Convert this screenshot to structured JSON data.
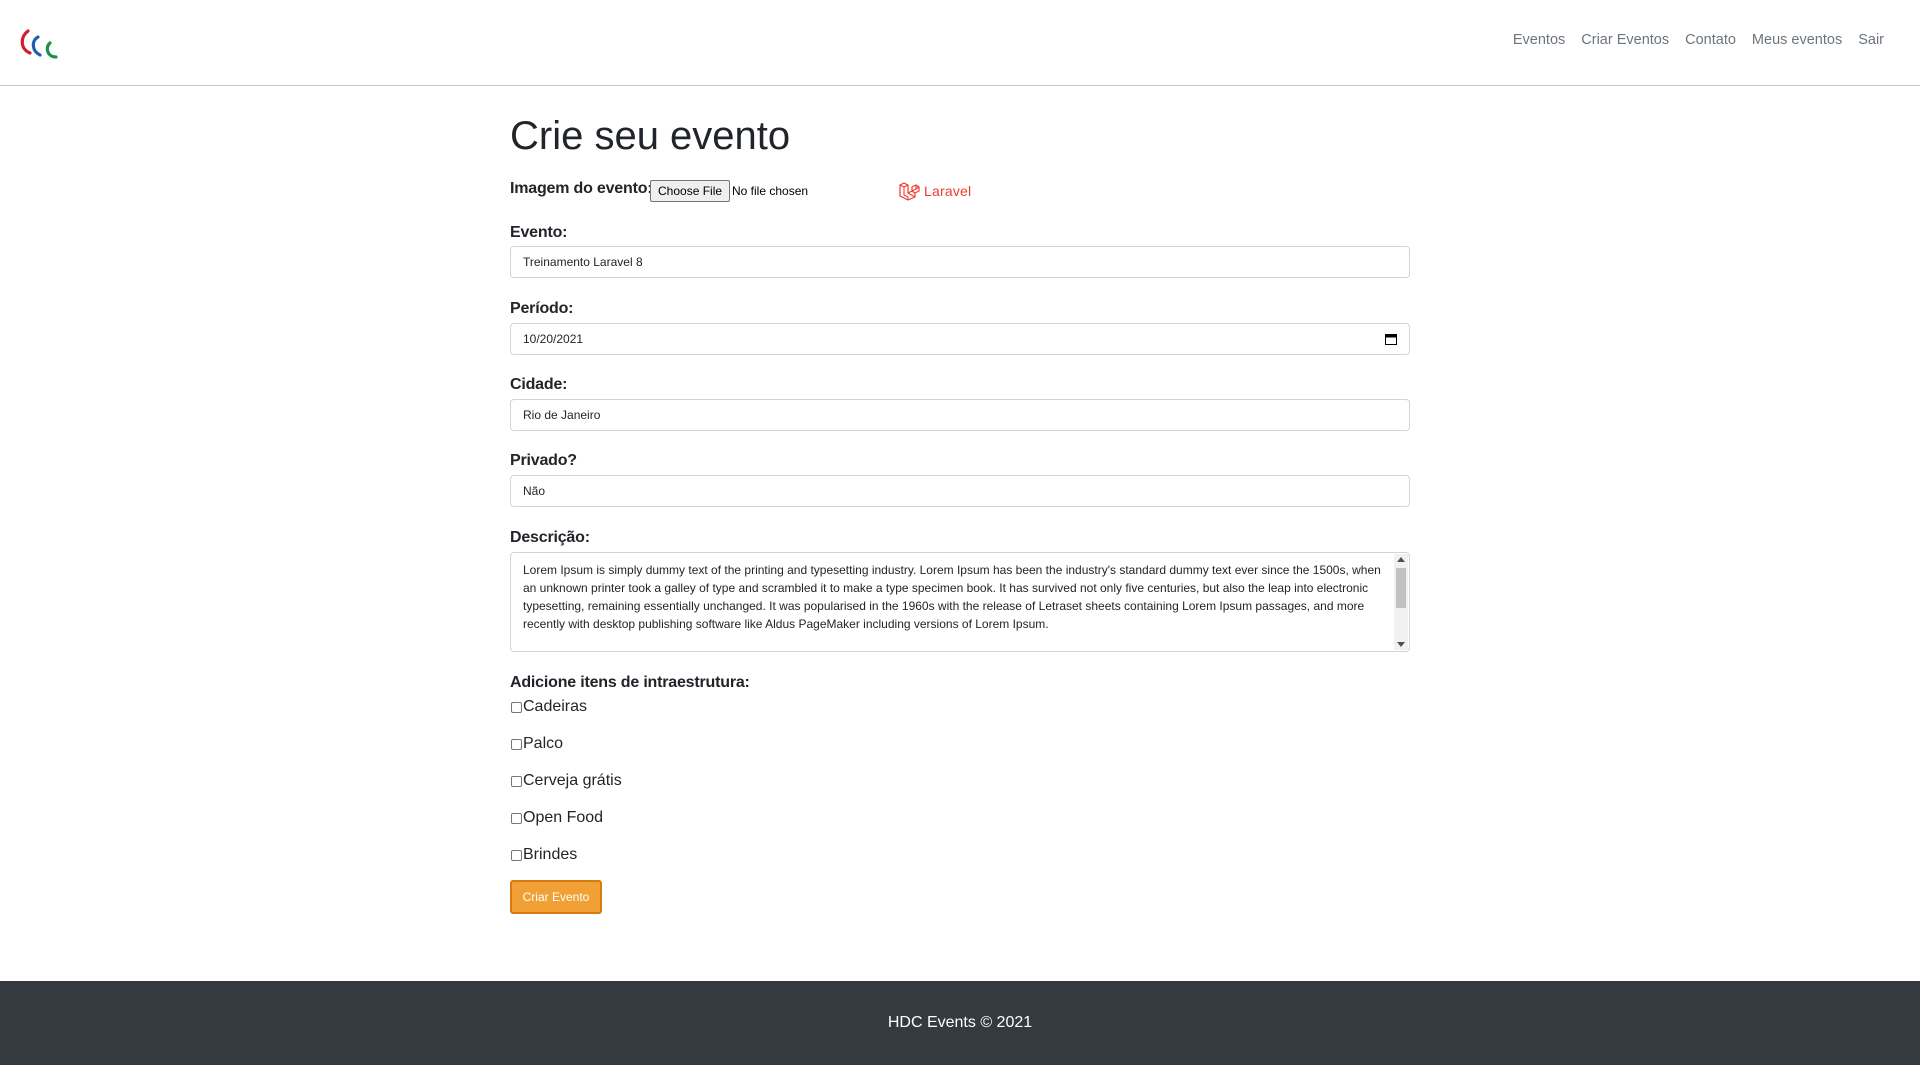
{
  "nav": {
    "logo": "paralympic-agitos-logo",
    "links": [
      "Eventos",
      "Criar Eventos",
      "Contato",
      "Meus eventos",
      "Sair"
    ]
  },
  "form": {
    "title": "Crie seu evento",
    "image_label": "Imagem do evento:",
    "file_button": "Choose File",
    "file_status": "No file chosen",
    "preview_logo_text": "Laravel",
    "event_label": "Evento:",
    "event_value": "Treinamento Laravel 8",
    "period_label": "Período:",
    "period_value": "10/20/2021",
    "city_label": "Cidade:",
    "city_value": "Rio de Janeiro",
    "private_label": "Privado?",
    "private_value": "Não",
    "description_label": "Descrição:",
    "description_value": "Lorem Ipsum is simply dummy text of the printing and typesetting industry. Lorem Ipsum has been the industry's standard dummy text ever since the 1500s, when an unknown printer took a galley of type and scrambled it to make a type specimen book. It has survived not only five centuries, but also the leap into electronic typesetting, remaining essentially unchanged. It was popularised in the 1960s with the release of Letraset sheets containing Lorem Ipsum passages, and more recently with desktop publishing software like Aldus PageMaker including versions of Lorem Ipsum.",
    "items_label": "Adicione itens de intraestrutura:",
    "items": [
      "Cadeiras",
      "Palco",
      "Cerveja grátis",
      "Open Food",
      "Brindes"
    ],
    "submit_label": "Criar Evento"
  },
  "footer": {
    "text": "HDC Events © 2021"
  },
  "colors": {
    "accent": "#f0a035",
    "accent_border": "#d97a10",
    "footer_bg": "#343a40",
    "laravel_red": "#ef3b2d"
  }
}
